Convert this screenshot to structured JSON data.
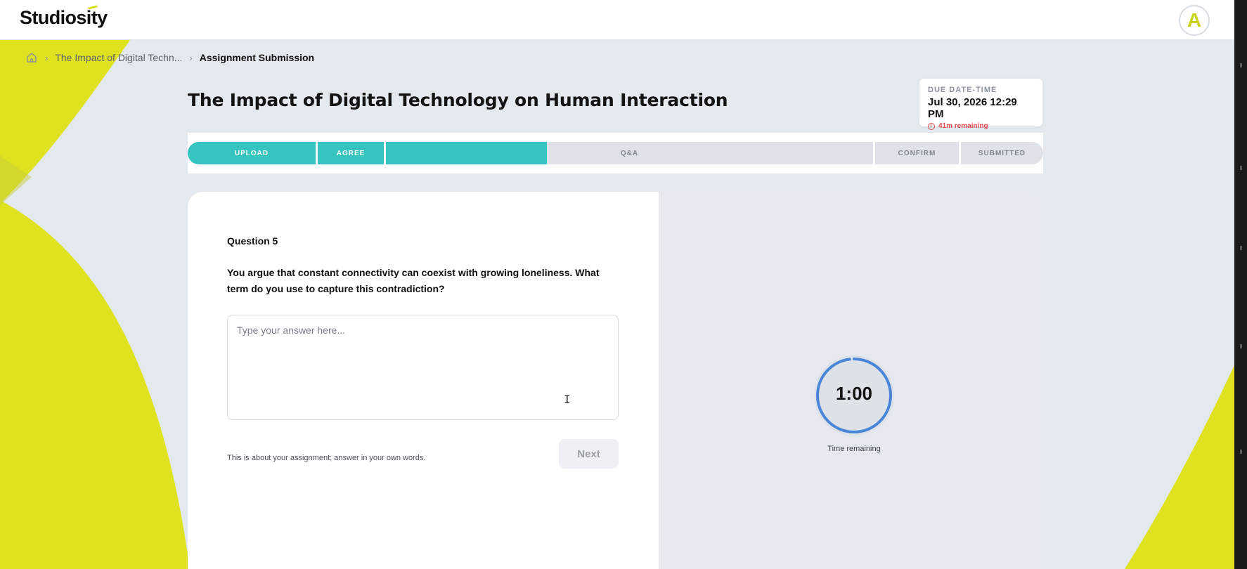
{
  "header": {
    "logo_text": "Studiosity",
    "avatar_letter": "A"
  },
  "breadcrumb": {
    "home_icon": "home-icon",
    "items": [
      {
        "label": "The Impact of Digital Techn..."
      },
      {
        "label": "Assignment Submission"
      }
    ]
  },
  "page": {
    "title": "The Impact of Digital Technology on Human Interaction"
  },
  "due": {
    "label": "DUE DATE-TIME",
    "date": "Jul 30, 2026 12:29 PM",
    "remaining": "41m remaining"
  },
  "stepper": {
    "steps": [
      {
        "label": "UPLOAD",
        "state": "done"
      },
      {
        "label": "AGREE",
        "state": "done"
      },
      {
        "label": "Q&A",
        "state": "in-progress",
        "progress": 0.33
      },
      {
        "label": "CONFIRM",
        "state": "todo"
      },
      {
        "label": "SUBMITTED",
        "state": "todo"
      }
    ]
  },
  "question": {
    "number_label": "Question 5",
    "text": "You argue that constant connectivity can coexist with growing loneliness. What term do you use to capture this contradiction?",
    "answer_placeholder": "Type your answer here...",
    "answer_value": "",
    "hint": "This is about your assignment; answer in your own words.",
    "next_label": "Next"
  },
  "timer": {
    "value": "1:00",
    "label": "Time remaining",
    "progress": 0.98
  },
  "colors": {
    "accent_teal": "#35c4c0",
    "brand_yellow": "#dfe21f",
    "warning_red": "#e04848",
    "timer_blue": "#4a86d8"
  }
}
